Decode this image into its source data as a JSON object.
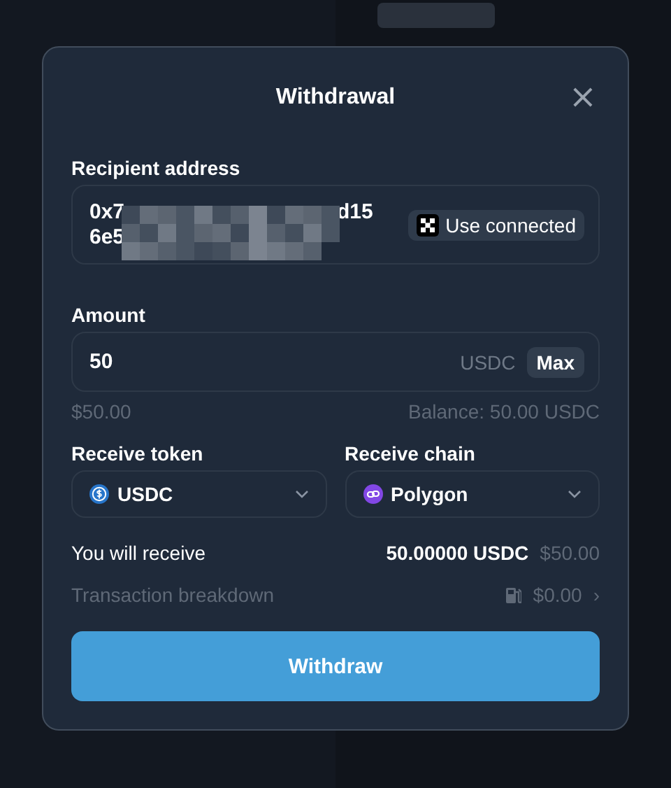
{
  "dialog": {
    "title": "Withdrawal",
    "close": "×"
  },
  "recipient": {
    "label": "Recipient address",
    "line_1_start": "0x7",
    "line_1_end": "d15",
    "line_2_start": "6e5",
    "use_connected": "Use connected"
  },
  "amount": {
    "label": "Amount",
    "value": "50",
    "unit": "USDC",
    "max": "Max",
    "usd_value": "$50.00",
    "balance": "Balance: 50.00 USDC"
  },
  "selects": [
    {
      "label": "Receive token",
      "value": "USDC",
      "kind": "token"
    },
    {
      "label": "Receive chain",
      "value": "Polygon",
      "kind": "chain"
    }
  ],
  "receive": {
    "label": "You will receive",
    "amount": "50.00000 USDC",
    "usd": "$50.00"
  },
  "breakdown": {
    "label": "Transaction breakdown",
    "fee": "$0.00",
    "arrow": "›"
  },
  "submit": "Withdraw"
}
